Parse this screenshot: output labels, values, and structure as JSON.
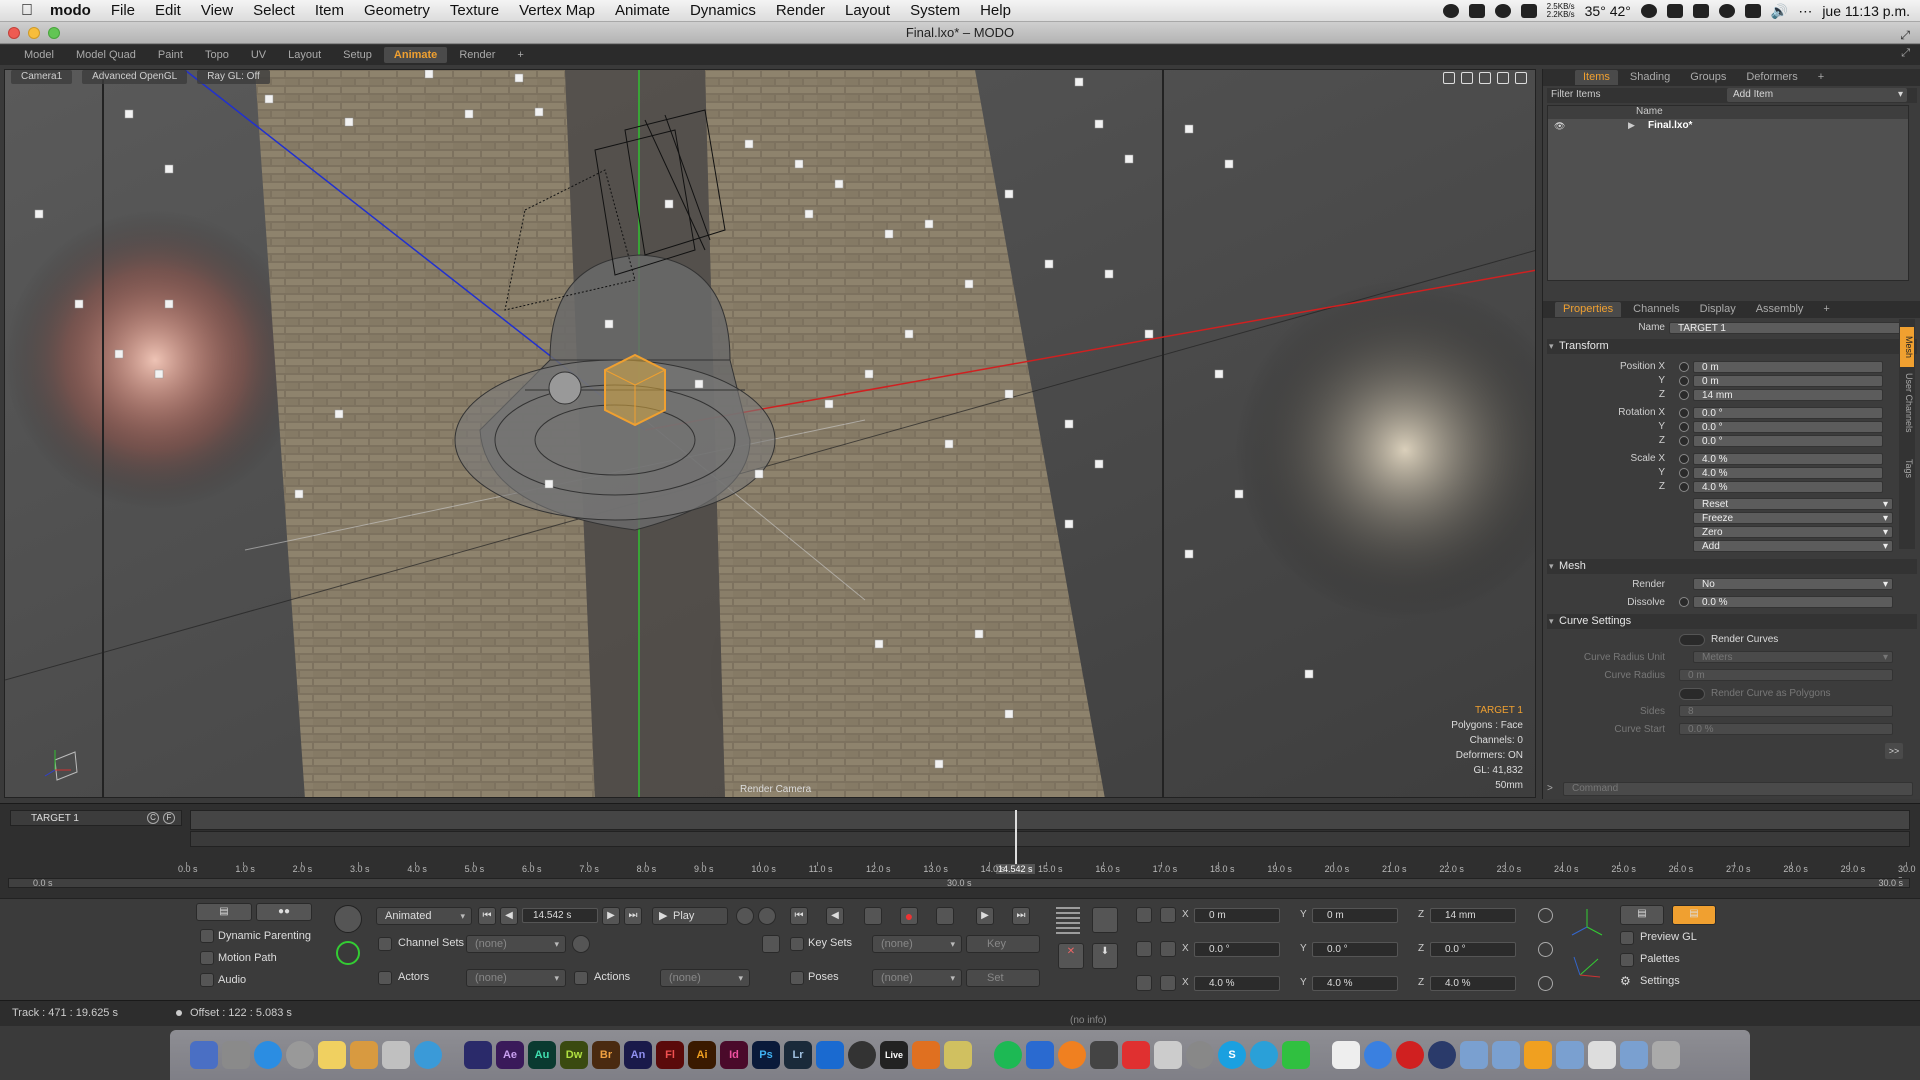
{
  "menubar": {
    "app": "modo",
    "items": [
      "File",
      "Edit",
      "View",
      "Select",
      "Item",
      "Geometry",
      "Texture",
      "Vertex Map",
      "Animate",
      "Dynamics",
      "Render",
      "Layout",
      "System",
      "Help"
    ],
    "net_up": "2.5KB/s",
    "net_down": "2.2KB/s",
    "temp": "35° 42°",
    "clock": "jue 11:13 p.m."
  },
  "window": {
    "title": "Final.lxo* – MODO"
  },
  "layout_tabs": [
    "Model",
    "Model Quad",
    "Paint",
    "Topo",
    "UV",
    "Layout",
    "Setup",
    "Animate",
    "Render"
  ],
  "layout_tabs_active": "Animate",
  "viewport": {
    "camera": "Camera1",
    "shading": "Advanced OpenGL",
    "raygl": "Ray GL: Off",
    "render_camera": "Render Camera",
    "info": {
      "target": "TARGET 1",
      "polygons": "Polygons : Face",
      "channels": "Channels: 0",
      "deformers": "Deformers: ON",
      "gl": "GL: 41,832",
      "focal": "50mm"
    }
  },
  "items_panel": {
    "tabs": [
      "Items",
      "Shading",
      "Groups",
      "Deformers"
    ],
    "active_tab": "Items",
    "filter_label": "Filter Items",
    "add_item": "Add Item",
    "col_name": "Name",
    "tree_item": "Final.lxo*"
  },
  "properties": {
    "tabs": [
      "Properties",
      "Channels",
      "Display",
      "Assembly"
    ],
    "active_tab": "Properties",
    "name_label": "Name",
    "name_value": "TARGET 1",
    "transform_label": "Transform",
    "position_label": "Position X",
    "position": [
      "0 m",
      "0 m",
      "14 mm"
    ],
    "rotation_label": "Rotation X",
    "rotation": [
      "0.0 °",
      "0.0 °",
      "0.0 °"
    ],
    "scale_label": "Scale X",
    "scale": [
      "4.0 %",
      "4.0 %",
      "4.0 %"
    ],
    "axis_y": "Y",
    "axis_z": "Z",
    "actions": [
      "Reset",
      "Freeze",
      "Zero",
      "Add"
    ],
    "mesh_label": "Mesh",
    "render_label": "Render",
    "render_value": "No",
    "dissolve_label": "Dissolve",
    "dissolve_value": "0.0 %",
    "curve_label": "Curve Settings",
    "render_curves": "Render Curves",
    "curve_radius_unit_label": "Curve Radius Unit",
    "curve_radius_unit": "Meters",
    "curve_radius_label": "Curve Radius",
    "curve_radius": "0 m",
    "render_curve_polys": "Render Curve as Polygons",
    "sides_label": "Sides",
    "sides": "8",
    "curve_start_label": "Curve Start",
    "curve_start": "0.0 %",
    "side_tabs": [
      "Mesh",
      "User Channels",
      "Tags"
    ],
    "command_placeholder": "Command"
  },
  "timeline": {
    "track": "TARGET 1",
    "current_time": "14.542 s",
    "start_label": "0.0 s",
    "mid_label": "30.0 s",
    "end_label": "30.0 s",
    "ticks": [
      "0.0 s",
      "1.0 s",
      "2.0 s",
      "3.0 s",
      "4.0 s",
      "5.0 s",
      "6.0 s",
      "7.0 s",
      "8.0 s",
      "9.0 s",
      "10.0 s",
      "11.0 s",
      "12.0 s",
      "13.0 s",
      "14.0 s",
      "15.0 s",
      "16.0 s",
      "17.0 s",
      "18.0 s",
      "19.0 s",
      "20.0 s",
      "21.0 s",
      "22.0 s",
      "23.0 s",
      "24.0 s",
      "25.0 s",
      "26.0 s",
      "27.0 s",
      "28.0 s",
      "29.0 s",
      "30.0 s"
    ]
  },
  "bottom": {
    "dynamic_parenting": "Dynamic Parenting",
    "motion_path": "Motion Path",
    "audio": "Audio",
    "animated": "Animated",
    "time": "14.542 s",
    "play": "Play",
    "channel_sets": "Channel Sets",
    "none": "(none)",
    "actors": "Actors",
    "actions": "Actions",
    "key_sets": "Key Sets",
    "key": "Key",
    "poses": "Poses",
    "set": "Set",
    "pos": [
      "0 m",
      "0 m",
      "14 mm"
    ],
    "rot": [
      "0.0 °",
      "0.0 °",
      "0.0 °"
    ],
    "scl": [
      "4.0 %",
      "4.0 %",
      "4.0 %"
    ],
    "ax_x": "X",
    "ax_y": "Y",
    "ax_z": "Z",
    "preview_gl": "Preview GL",
    "palettes": "Palettes",
    "settings": "Settings"
  },
  "status": {
    "track": "Track : 471 : 19.625 s",
    "offset": "Offset : 122 : 5.083 s",
    "info": "(no info)"
  },
  "dock": [
    "Ae",
    "Au",
    "Dw",
    "Br",
    "An",
    "Fl",
    "Ai",
    "Id",
    "Ps",
    "Lr",
    "Live"
  ],
  "colors": {
    "accent": "#f0a030",
    "panel": "#3c3c3c",
    "x_axis": "#d03030",
    "y_axis": "#30c030",
    "z_axis": "#3040d0"
  }
}
